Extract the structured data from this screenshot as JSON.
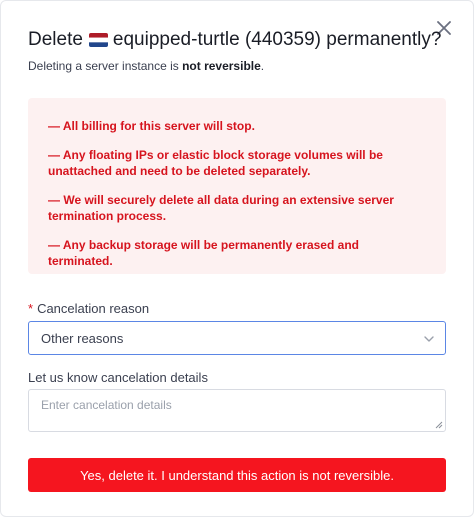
{
  "dialog": {
    "title_prefix": "Delete",
    "server_name": "equipped-turtle (440359) permanently?",
    "subtitle_prefix": "Deleting a server instance is ",
    "subtitle_bold": "not reversible",
    "subtitle_suffix": ".",
    "flag_icon": "netherlands-flag-icon",
    "close_icon": "close-icon"
  },
  "warnings": [
    "— All billing for this server will stop.",
    "— Any floating IPs or elastic block storage volumes will be unattached and need to be deleted separately.",
    "— We will securely delete all data during an extensive server termination process.",
    "— Any backup storage will be permanently erased and terminated."
  ],
  "cancel_reason": {
    "required_mark": "*",
    "label": "Cancelation reason",
    "selected": "Other reasons"
  },
  "details": {
    "label": "Let us know cancelation details",
    "placeholder": "Enter cancelation details",
    "value": ""
  },
  "confirm_button": {
    "label": "Yes, delete it. I understand this action is not reversible."
  },
  "colors": {
    "danger": "#f5151f",
    "danger_text": "#d6141e",
    "warning_bg": "#fdf1f1",
    "focus_border": "#5b86e5"
  }
}
